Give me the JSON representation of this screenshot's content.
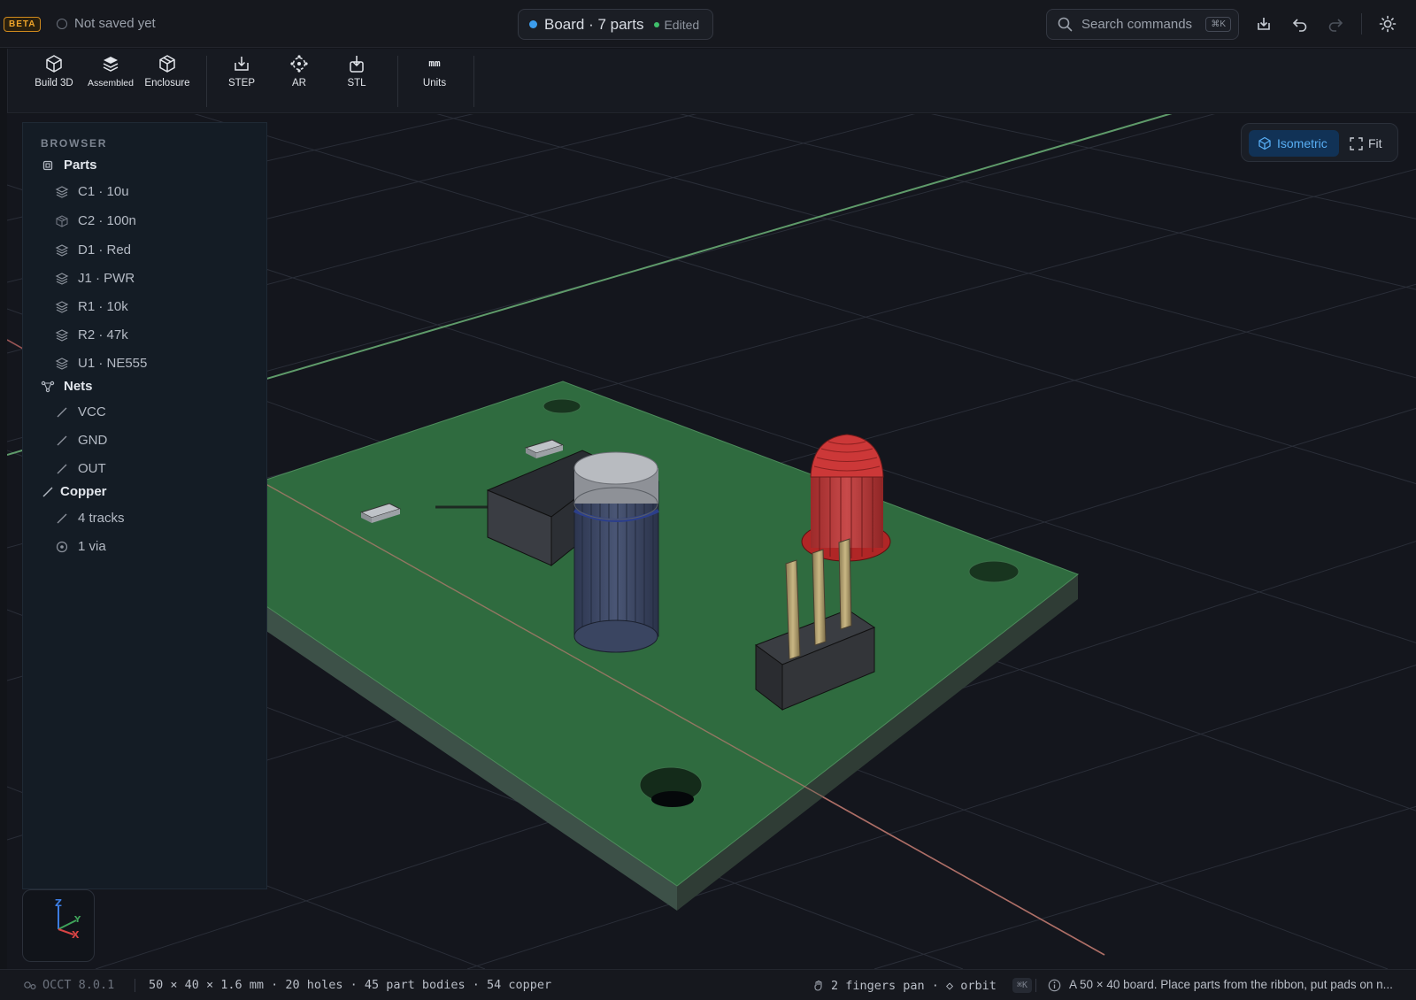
{
  "topbar": {
    "badge": "BETA",
    "save_status": "Not saved yet",
    "doc_title": "Board · 7 parts",
    "doc_state": "Edited",
    "search_placeholder": "Search commands",
    "search_shortcut": "⌘K",
    "icons": [
      "download-icon",
      "undo-icon",
      "redo-icon",
      "theme-sun-icon"
    ]
  },
  "ribbon": {
    "buttons": [
      {
        "label": "Build 3D",
        "icon": "cube-icon"
      },
      {
        "label": "Assembled",
        "icon": "layers-icon"
      },
      {
        "label": "Enclosure",
        "icon": "box-icon"
      },
      {
        "label": "STEP",
        "icon": "export-icon"
      },
      {
        "label": "AR",
        "icon": "ar-icon"
      },
      {
        "label": "STL",
        "icon": "export-stl-icon"
      },
      {
        "label": "Units",
        "icon_text": "mm"
      }
    ]
  },
  "browser": {
    "heading": "BROWSER",
    "parts_label": "Parts",
    "parts": [
      "C1 · 10u",
      "C2 · 100n",
      "D1 · Red",
      "J1 · PWR",
      "R1 · 10k",
      "R2 · 47k",
      "U1 · NE555"
    ],
    "nets_label": "Nets",
    "nets": [
      "VCC",
      "GND",
      "OUT"
    ],
    "copper_label": "Copper",
    "copper": [
      "4 tracks",
      "1 via"
    ]
  },
  "view": {
    "iso_label": "Isometric",
    "fit_label": "Fit"
  },
  "gizmo": {
    "z": "Z",
    "y": "Y",
    "x": "X"
  },
  "status": {
    "engine": "OCCT 8.0.1",
    "summary": "50 × 40 × 1.6 mm · 20 holes · 45 part bodies · 54 copper",
    "nav_hint": "2 fingers pan · ◇ orbit",
    "nav_kbd": "⌘K",
    "message": "A 50 × 40 board. Place parts from the ribbon, put pads on n..."
  },
  "colors": {
    "accent": "#3c9ded",
    "board": "#2f6b3f",
    "led": "#d13a3a",
    "capacitor": "#3b4766",
    "beta": "#f0a52a"
  }
}
